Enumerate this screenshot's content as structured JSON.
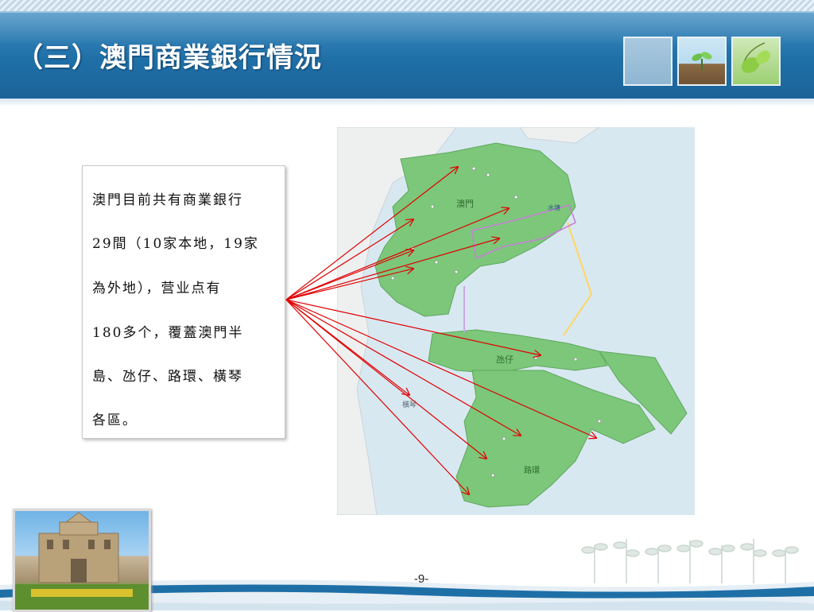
{
  "slide": {
    "title": "（三）澳門商業銀行情況",
    "page_number": "-9-"
  },
  "textbox": {
    "line1": "澳門目前共有商業銀行",
    "line2": "29間（10家本地，19家",
    "line3": "為外地），营业点有",
    "line4": "180多个，覆蓋澳門半",
    "line5": "島、氹仔、路環、橫琴",
    "line6": "各區。"
  },
  "colors": {
    "title_bar": "#1f6fa7",
    "arrow": "#e00000",
    "land_green": "#7cc77a",
    "sea": "#d8e8f1"
  },
  "map": {
    "region_labels": {
      "macau": "澳門",
      "taipa": "氹仔",
      "coloane": "路環",
      "hengqin": "橫琴",
      "water_nearby": "水塘"
    }
  }
}
